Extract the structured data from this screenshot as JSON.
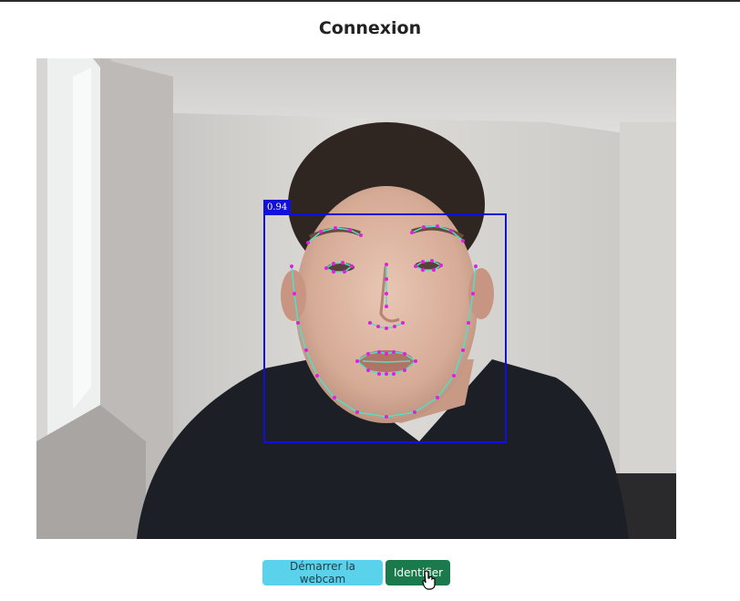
{
  "page": {
    "title": "Connexion"
  },
  "video": {
    "detection_score": "0.94",
    "box_color": "#1010d8",
    "landmark_line_color": "#4fe0c8",
    "landmark_point_color": "#e020e0"
  },
  "buttons": {
    "start_webcam_label": "Démarrer la webcam",
    "identify_label": "Identifier"
  },
  "colors": {
    "webcam_button": "#5bd2ec",
    "identify_button": "#1a7a4c"
  }
}
